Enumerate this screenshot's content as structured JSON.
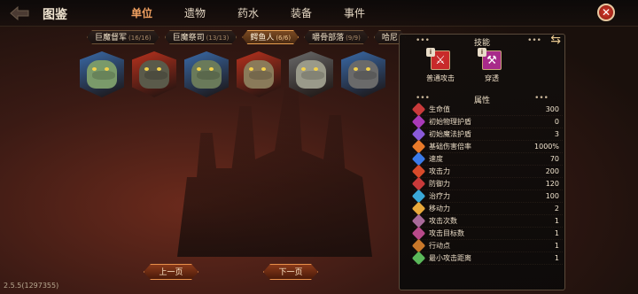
{
  "header": {
    "title": "图鉴",
    "tabs": [
      {
        "label": "单位",
        "active": true
      },
      {
        "label": "遗物",
        "active": false
      },
      {
        "label": "药水",
        "active": false
      },
      {
        "label": "装备",
        "active": false
      },
      {
        "label": "事件",
        "active": false
      }
    ],
    "close_icon": "close-icon",
    "back_icon": "back-icon"
  },
  "categories": [
    {
      "label": "巨魔督军",
      "count": "(16/16)",
      "active": false
    },
    {
      "label": "巨魔祭司",
      "count": "(13/13)",
      "active": false
    },
    {
      "label": "鳄鱼人",
      "count": "(6/6)",
      "active": true
    },
    {
      "label": "嚼骨部落",
      "count": "(9/9)",
      "active": false
    },
    {
      "label": "哈尼",
      "count": "",
      "active": false
    }
  ],
  "portraits": [
    {
      "name": "crocodile-unit-1",
      "frame": "#3a6aa8",
      "skin": "#7a9a6a"
    },
    {
      "name": "crocodile-unit-2",
      "frame": "#b8321e",
      "skin": "#5a5a4a"
    },
    {
      "name": "crocodile-unit-3",
      "frame": "#3a6aa8",
      "skin": "#6a7a5a"
    },
    {
      "name": "crocodile-unit-4",
      "frame": "#b8321e",
      "skin": "#8a7a5a"
    },
    {
      "name": "crocodile-unit-5",
      "frame": "#6a6a6a",
      "skin": "#9a9a8a"
    },
    {
      "name": "crocodile-unit-6",
      "frame": "#3a6aa8",
      "skin": "#6a6a6a"
    }
  ],
  "skills_panel": {
    "title": "技能",
    "skills": [
      {
        "label": "普通攻击",
        "icon": "sword-icon",
        "glyph": "⚔",
        "color": "#c82a2a"
      },
      {
        "label": "穿透",
        "icon": "pierce-icon",
        "glyph": "⚒",
        "color": "#a82a8a"
      }
    ],
    "attributes_title": "属性",
    "attributes": [
      {
        "name": "生命值",
        "value": "300",
        "color": "#c83a3a"
      },
      {
        "name": "初始物理护盾",
        "value": "0",
        "color": "#a83ab8"
      },
      {
        "name": "初始魔法护盾",
        "value": "3",
        "color": "#8a5ad8"
      },
      {
        "name": "基础伤害倍率",
        "value": "1000%",
        "color": "#e87a2a"
      },
      {
        "name": "速度",
        "value": "70",
        "color": "#3a7ae8"
      },
      {
        "name": "攻击力",
        "value": "200",
        "color": "#d84a2a"
      },
      {
        "name": "防御力",
        "value": "120",
        "color": "#c83a3a"
      },
      {
        "name": "治疗力",
        "value": "100",
        "color": "#3aa8d8"
      },
      {
        "name": "移动力",
        "value": "2",
        "color": "#e8a83a"
      },
      {
        "name": "攻击次数",
        "value": "1",
        "color": "#a86a9a"
      },
      {
        "name": "攻击目标数",
        "value": "1",
        "color": "#b84a8a"
      },
      {
        "name": "行动点",
        "value": "1",
        "color": "#c8782a"
      },
      {
        "name": "最小攻击距离",
        "value": "1",
        "color": "#5ab85a"
      }
    ]
  },
  "pagination": {
    "prev": "上一页",
    "next": "下一页"
  },
  "version": "2.5.5(1297355)"
}
